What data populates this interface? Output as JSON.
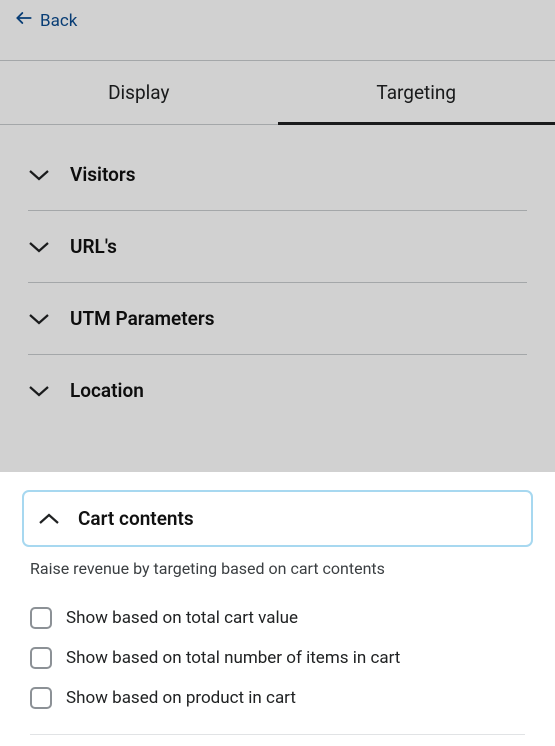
{
  "header": {
    "back_label": "Back"
  },
  "tabs": {
    "display": "Display",
    "targeting": "Targeting"
  },
  "sections": {
    "visitors": "Visitors",
    "urls": "URL's",
    "utm": "UTM Parameters",
    "location": "Location",
    "cart": "Cart contents"
  },
  "cart_panel": {
    "description": "Raise revenue by targeting based on cart contents",
    "options": {
      "total_value": "Show based on total cart value",
      "total_items": "Show based on total number of items in cart",
      "product": "Show based on product in cart"
    }
  }
}
